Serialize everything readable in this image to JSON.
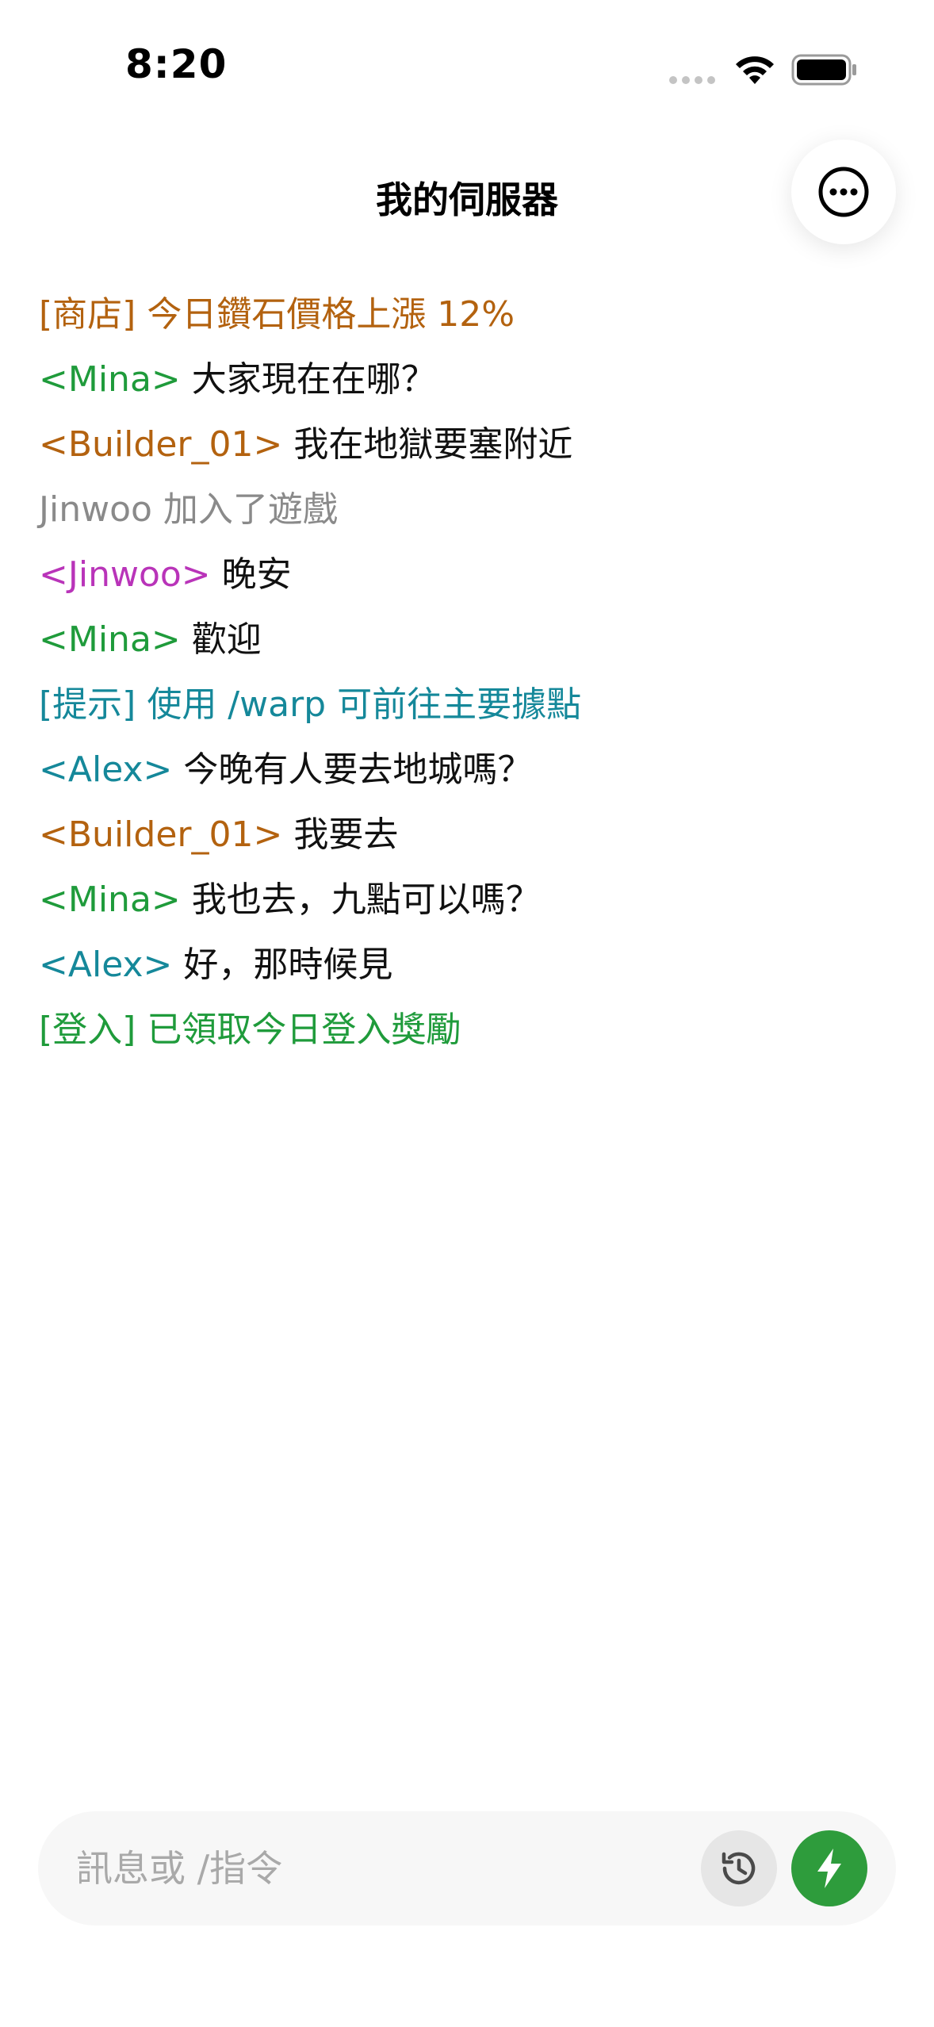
{
  "status_bar": {
    "time": "8:20"
  },
  "header": {
    "title": "我的伺服器",
    "more_icon": "more-horizontal-circle-icon"
  },
  "colors": {
    "orange": "#b3620f",
    "green": "#1f9b3b",
    "gray": "#8a8a8a",
    "magenta": "#b934b9",
    "teal": "#15889a",
    "accent_button": "#2e9c3c"
  },
  "chat": {
    "lines": [
      {
        "prefix": "[商店] 今日鑽石價格上漲 12%",
        "msg": "",
        "color": "#b3620f"
      },
      {
        "prefix": "<Mina>",
        "msg": " 大家現在在哪？",
        "color": "#1f9b3b"
      },
      {
        "prefix": "<Builder_01>",
        "msg": " 我在地獄要塞附近",
        "color": "#b3620f"
      },
      {
        "prefix": "Jinwoo 加入了遊戲",
        "msg": "",
        "color": "#8a8a8a"
      },
      {
        "prefix": "<Jinwoo>",
        "msg": " 晚安",
        "color": "#b934b9"
      },
      {
        "prefix": "<Mina>",
        "msg": " 歡迎",
        "color": "#1f9b3b"
      },
      {
        "prefix": "[提示] 使用 /warp 可前往主要據點",
        "msg": "",
        "color": "#15889a"
      },
      {
        "prefix": "<Alex>",
        "msg": " 今晚有人要去地城嗎？",
        "color": "#15889a"
      },
      {
        "prefix": "<Builder_01>",
        "msg": " 我要去",
        "color": "#b3620f"
      },
      {
        "prefix": "<Mina>",
        "msg": " 我也去，九點可以嗎？",
        "color": "#1f9b3b"
      },
      {
        "prefix": "<Alex>",
        "msg": " 好，那時候見",
        "color": "#15889a"
      },
      {
        "prefix": "[登入] 已領取今日登入獎勵",
        "msg": "",
        "color": "#1f9b3b"
      }
    ]
  },
  "composer": {
    "placeholder": "訊息或 /指令",
    "value": "",
    "history_icon": "history-icon",
    "send_icon": "lightning-bolt-icon"
  }
}
